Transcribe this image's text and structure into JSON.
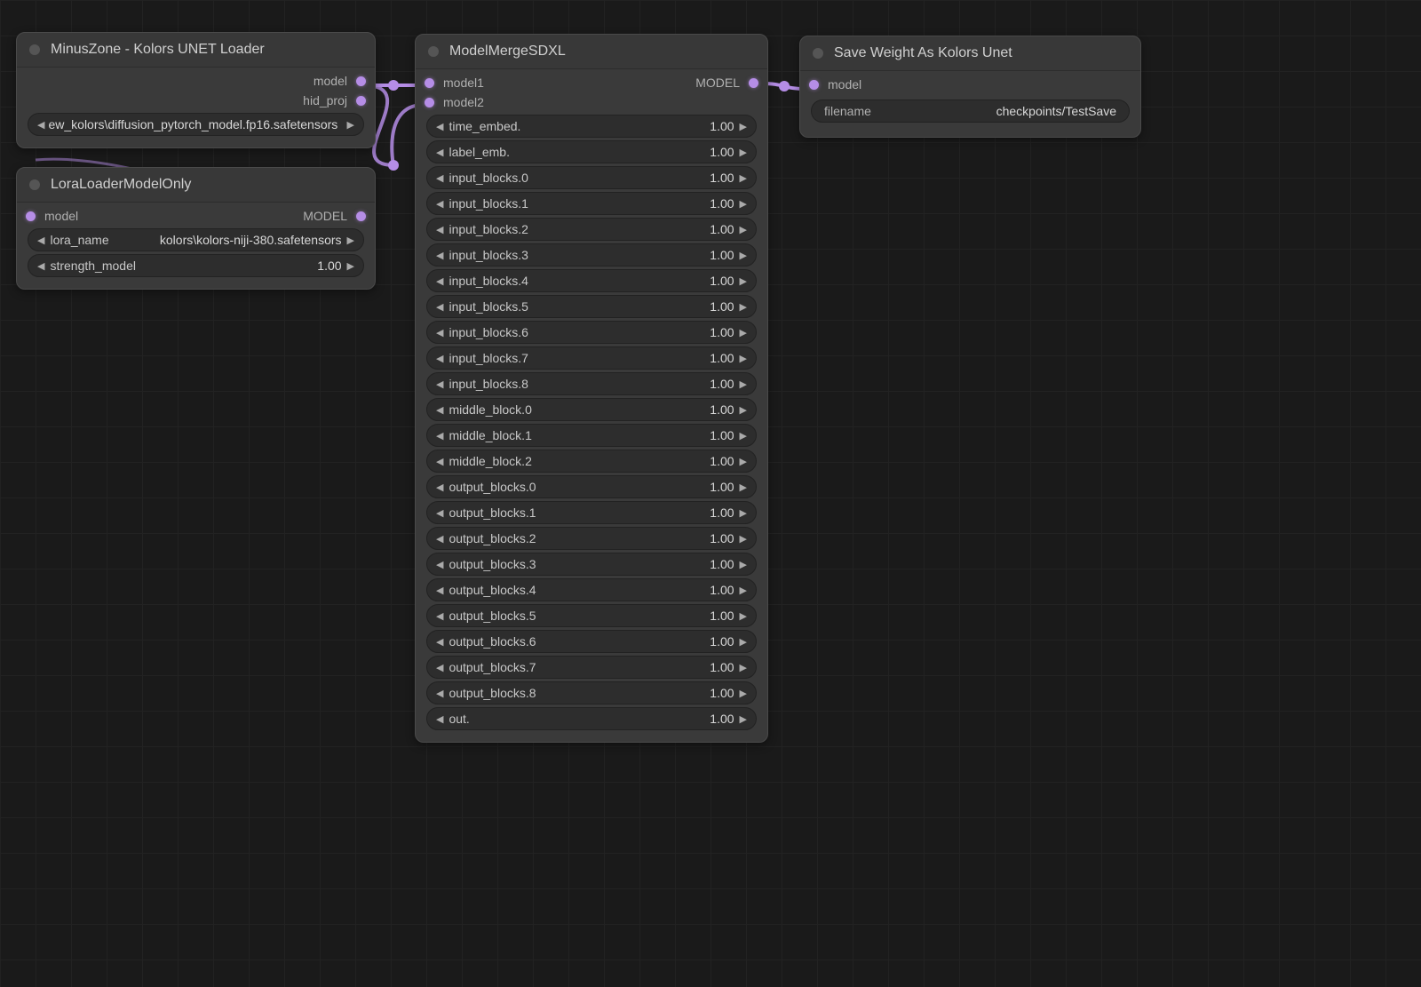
{
  "nodes": {
    "unet_loader": {
      "title": "MinusZone - Kolors UNET Loader",
      "outputs": {
        "model": "model",
        "hid_proj": "hid_proj"
      },
      "widget": {
        "label": "ew_kolors\\diffusion_pytorch_model.fp16.safetensors"
      }
    },
    "lora_loader": {
      "title": "LoraLoaderModelOnly",
      "inputs": {
        "model": "model"
      },
      "outputs": {
        "model": "MODEL"
      },
      "widgets": {
        "lora_name": {
          "label": "lora_name",
          "value": "kolors\\kolors-niji-380.safetensors"
        },
        "strength_model": {
          "label": "strength_model",
          "value": "1.00"
        }
      }
    },
    "merge": {
      "title": "ModelMergeSDXL",
      "inputs": {
        "model1": "model1",
        "model2": "model2"
      },
      "outputs": {
        "model": "MODEL"
      },
      "params": [
        {
          "label": "time_embed.",
          "value": "1.00"
        },
        {
          "label": "label_emb.",
          "value": "1.00"
        },
        {
          "label": "input_blocks.0",
          "value": "1.00"
        },
        {
          "label": "input_blocks.1",
          "value": "1.00"
        },
        {
          "label": "input_blocks.2",
          "value": "1.00"
        },
        {
          "label": "input_blocks.3",
          "value": "1.00"
        },
        {
          "label": "input_blocks.4",
          "value": "1.00"
        },
        {
          "label": "input_blocks.5",
          "value": "1.00"
        },
        {
          "label": "input_blocks.6",
          "value": "1.00"
        },
        {
          "label": "input_blocks.7",
          "value": "1.00"
        },
        {
          "label": "input_blocks.8",
          "value": "1.00"
        },
        {
          "label": "middle_block.0",
          "value": "1.00"
        },
        {
          "label": "middle_block.1",
          "value": "1.00"
        },
        {
          "label": "middle_block.2",
          "value": "1.00"
        },
        {
          "label": "output_blocks.0",
          "value": "1.00"
        },
        {
          "label": "output_blocks.1",
          "value": "1.00"
        },
        {
          "label": "output_blocks.2",
          "value": "1.00"
        },
        {
          "label": "output_blocks.3",
          "value": "1.00"
        },
        {
          "label": "output_blocks.4",
          "value": "1.00"
        },
        {
          "label": "output_blocks.5",
          "value": "1.00"
        },
        {
          "label": "output_blocks.6",
          "value": "1.00"
        },
        {
          "label": "output_blocks.7",
          "value": "1.00"
        },
        {
          "label": "output_blocks.8",
          "value": "1.00"
        },
        {
          "label": "out.",
          "value": "1.00"
        }
      ]
    },
    "save": {
      "title": "Save Weight As Kolors Unet",
      "inputs": {
        "model": "model"
      },
      "widget": {
        "label": "filename",
        "value": "checkpoints/TestSave"
      }
    }
  },
  "glyphs": {
    "left": "◀",
    "right": "▶"
  }
}
